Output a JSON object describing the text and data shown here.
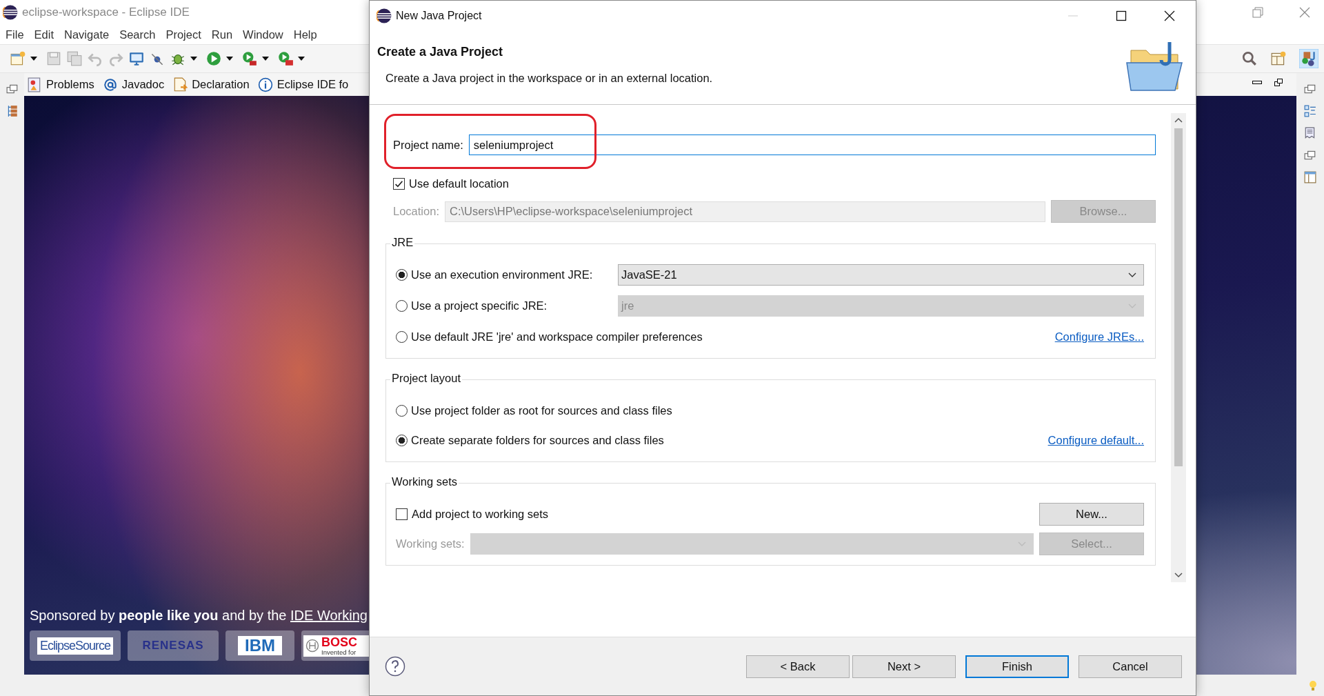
{
  "ide": {
    "title": "eclipse-workspace - Eclipse IDE",
    "menu": [
      "File",
      "Edit",
      "Navigate",
      "Search",
      "Project",
      "Run",
      "Window",
      "Help"
    ],
    "views": [
      {
        "kind": "problems",
        "label": "Problems"
      },
      {
        "kind": "javadoc",
        "label": "Javadoc"
      },
      {
        "kind": "declaration",
        "label": "Declaration"
      },
      {
        "kind": "info",
        "label": "Eclipse IDE fo"
      }
    ],
    "sponsor": {
      "text": "Sponsored by **people like you** and by the ",
      "link": "IDE Working"
    },
    "logos": [
      {
        "kind": "eclipsesource",
        "text": "EclipseSource"
      },
      {
        "kind": "renesas",
        "text": "RENESAS"
      },
      {
        "kind": "ibm",
        "text": "IBM"
      },
      {
        "kind": "bosch",
        "text": "BOSC",
        "subtext": "Invented for"
      }
    ]
  },
  "dialog": {
    "title": "New Java Project",
    "heading": "Create a Java Project",
    "description": "Create a Java project in the workspace or in an external location.",
    "project_name": {
      "label": "Project name:",
      "value": "seleniumproject"
    },
    "use_default_location": {
      "label": "Use default location",
      "checked": true
    },
    "location": {
      "label": "Location:",
      "value": "C:\\Users\\HP\\eclipse-workspace\\seleniumproject",
      "browse": "Browse..."
    },
    "jre": {
      "title": "JRE",
      "options": [
        {
          "label": "Use an execution environment JRE:",
          "selected": true,
          "combo": "JavaSE-21"
        },
        {
          "label": "Use a project specific JRE:",
          "selected": false,
          "combo": "jre"
        },
        {
          "label": "Use default JRE 'jre' and workspace compiler preferences",
          "selected": false,
          "link": "Configure JREs..."
        }
      ]
    },
    "project_layout": {
      "title": "Project layout",
      "options": [
        {
          "label": "Use project folder as root for sources and class files",
          "selected": false
        },
        {
          "label": "Create separate folders for sources and class files",
          "selected": true,
          "link": "Configure default..."
        }
      ]
    },
    "working_sets": {
      "title": "Working sets",
      "add": {
        "label": "Add project to working sets",
        "checked": false
      },
      "new_button": "New...",
      "label": "Working sets:",
      "select_button": "Select..."
    },
    "buttons": [
      {
        "label": "< Back",
        "default": false
      },
      {
        "label": "Next >",
        "default": false
      },
      {
        "label": "Finish",
        "default": true
      },
      {
        "label": "Cancel",
        "default": false
      }
    ]
  }
}
